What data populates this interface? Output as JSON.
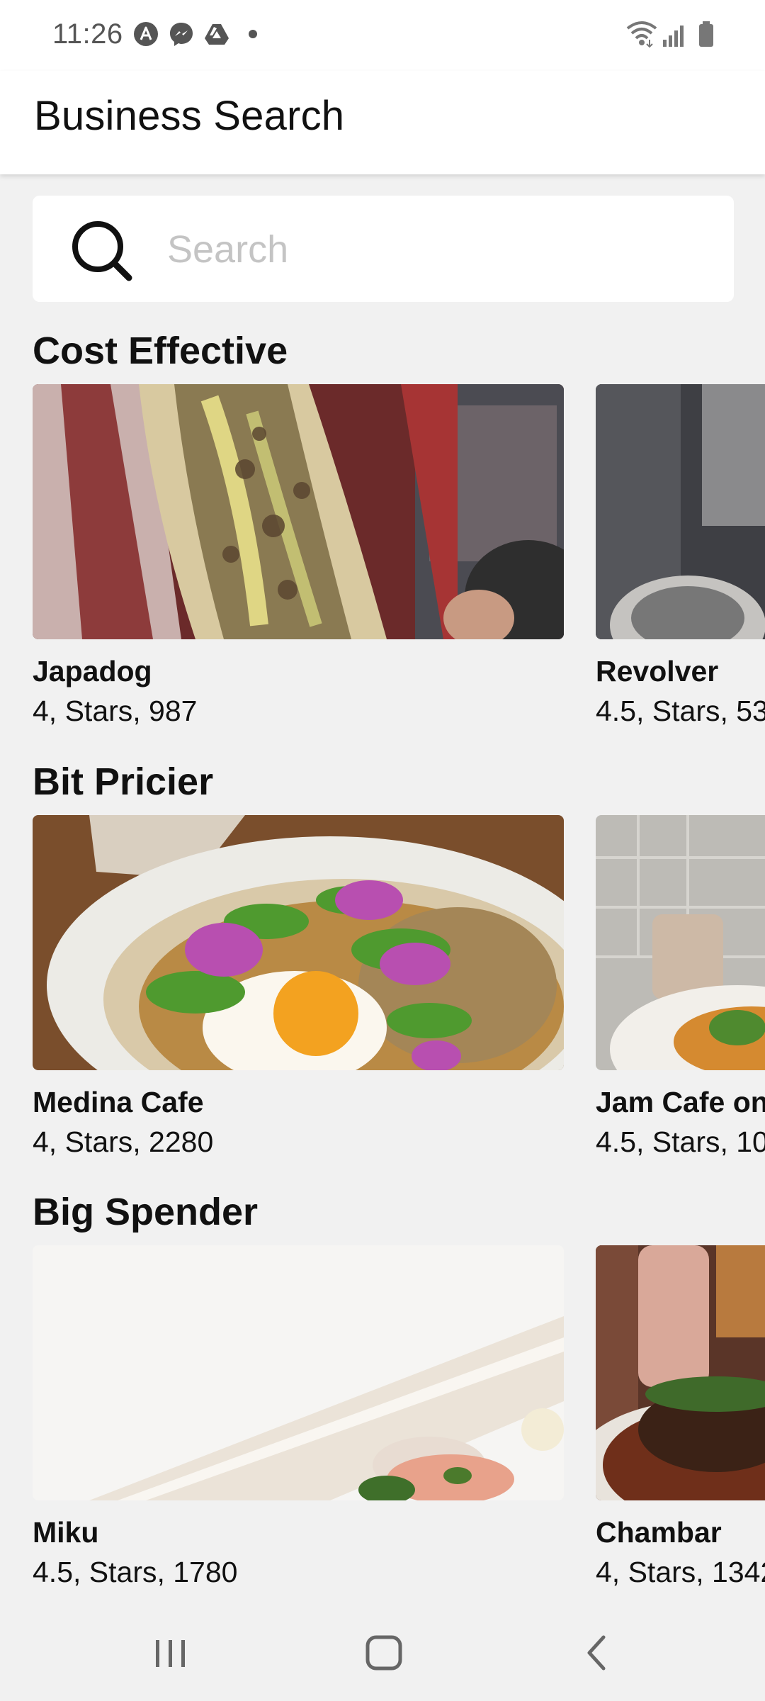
{
  "status_bar": {
    "time": "11:26",
    "notification_icons": [
      "arc-icon",
      "messenger-icon",
      "drive-icon",
      "dot-icon"
    ],
    "right_icons": [
      "wifi-icon",
      "signal-icon",
      "battery-icon"
    ]
  },
  "header": {
    "title": "Business Search"
  },
  "search": {
    "placeholder": "Search",
    "value": ""
  },
  "sections": [
    {
      "title": "Cost Effective",
      "cards": [
        {
          "name": "Japadog",
          "meta": "4, Stars, 987"
        },
        {
          "name": "Revolver",
          "meta": "4.5, Stars, 53"
        }
      ]
    },
    {
      "title": "Bit Pricier",
      "cards": [
        {
          "name": "Medina Cafe",
          "meta": "4, Stars, 2280"
        },
        {
          "name": "Jam Cafe on",
          "meta": "4.5, Stars, 10"
        }
      ]
    },
    {
      "title": "Big Spender",
      "cards": [
        {
          "name": "Miku",
          "meta": "4.5, Stars, 1780"
        },
        {
          "name": "Chambar",
          "meta": "4, Stars, 1342"
        }
      ]
    }
  ],
  "nav_bar": {
    "icons": [
      "recent-apps-icon",
      "home-icon",
      "back-icon"
    ]
  },
  "colors": {
    "background": "#f1f1f1",
    "surface": "#ffffff",
    "text": "#111111",
    "placeholder": "#c4c4c4"
  }
}
